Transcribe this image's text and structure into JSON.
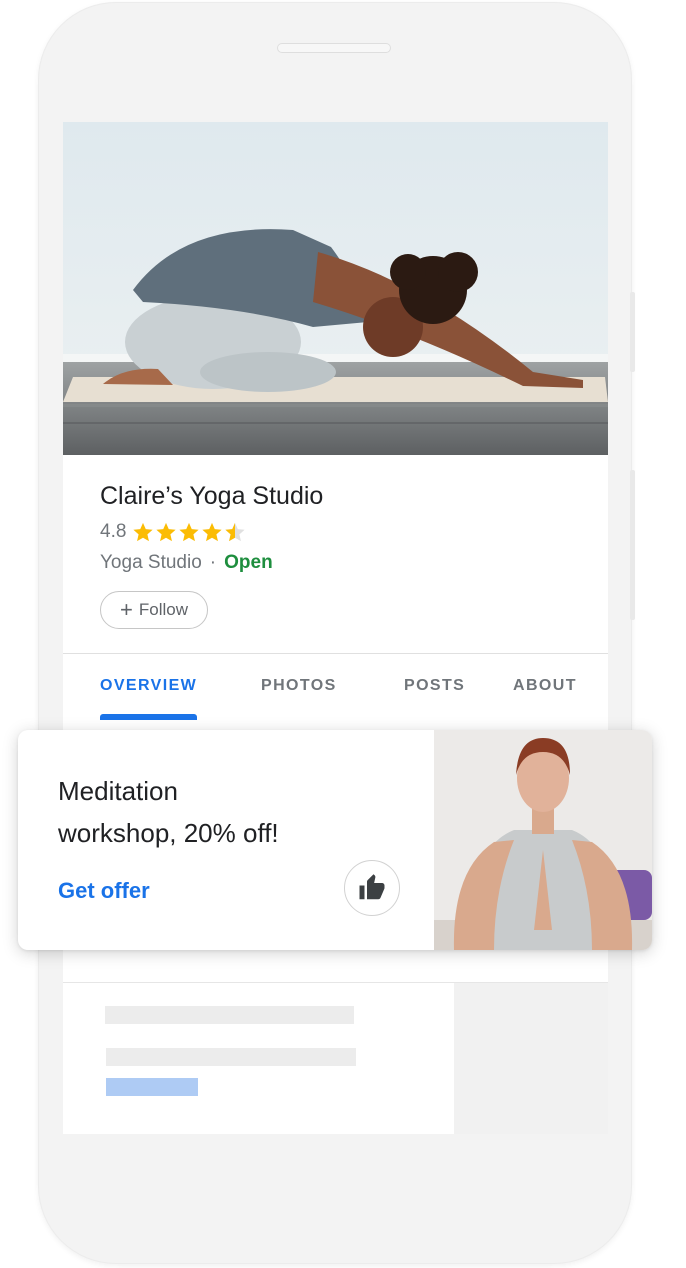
{
  "business": {
    "name": "Claire’s Yoga Studio",
    "rating": "4.8",
    "rating_value": 4.8,
    "rating_max": 5,
    "category": "Yoga Studio",
    "separator": "·",
    "status": "Open",
    "follow_icon": "+",
    "follow_label": "Follow"
  },
  "tabs": [
    {
      "label": "OVERVIEW",
      "active": true
    },
    {
      "label": "PHOTOS",
      "active": false
    },
    {
      "label": "POSTS",
      "active": false
    },
    {
      "label": "ABOUT",
      "active": false
    }
  ],
  "offer": {
    "line1": "Meditation",
    "line2": "workshop, 20% off!",
    "cta": "Get offer",
    "like_icon": "thumbs-up-icon"
  },
  "colors": {
    "accent": "#1a73e8",
    "open": "#1e8e3e",
    "star": "#fbbc04",
    "text_secondary": "#70757a"
  }
}
